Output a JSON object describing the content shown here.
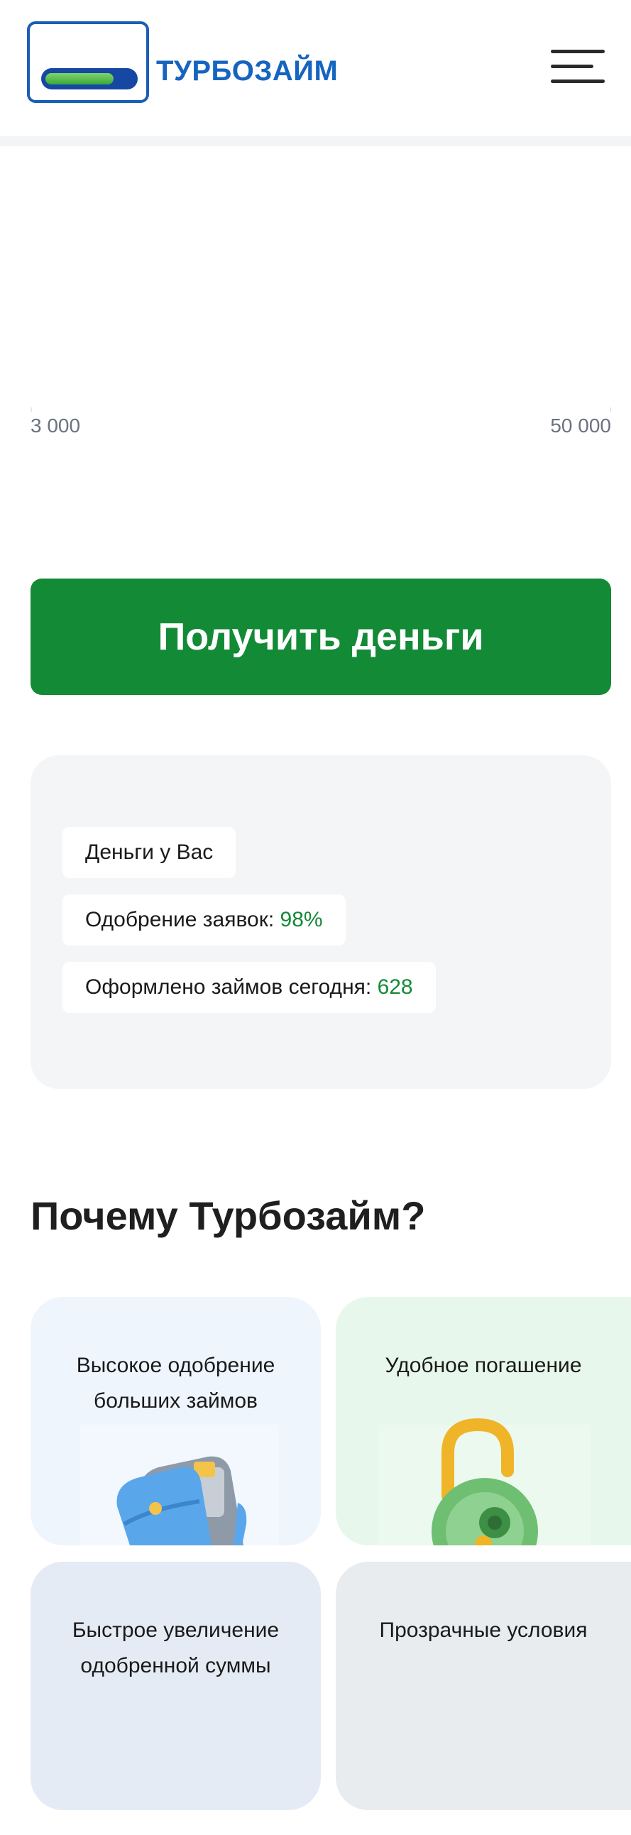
{
  "header": {
    "logo_text": "ТУРБОЗАЙМ",
    "menu_icon": "hamburger-menu-icon"
  },
  "slider": {
    "min_label": "3 000",
    "max_label": "50 000"
  },
  "cta": {
    "label": "Получить деньги"
  },
  "stats": {
    "money_label": "Деньги у Вас",
    "approval_label": "Одобрение заявок:",
    "approval_value": "98%",
    "issued_label": "Оформлено займов сегодня:",
    "issued_value": "628"
  },
  "why": {
    "title": "Почему Турбозайм?",
    "features": [
      {
        "title": "Высокое одобрение больших займов",
        "icon": "wallet-icon"
      },
      {
        "title": "Удобное погашение",
        "icon": "padlock-icon"
      },
      {
        "title": "Быстрое увеличение одобренной суммы",
        "icon": ""
      },
      {
        "title": "Прозрачные условия",
        "icon": ""
      }
    ]
  },
  "colors": {
    "brand_blue": "#1565c0",
    "accent_green": "#138a36"
  }
}
